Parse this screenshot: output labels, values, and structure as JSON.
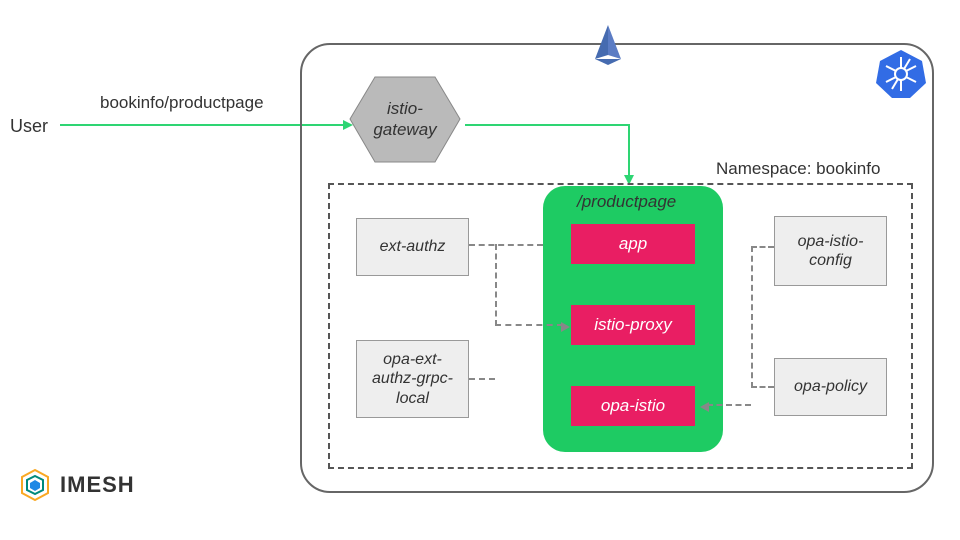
{
  "user_label": "User",
  "arrow1_label": "bookinfo/productpage",
  "gateway_label": "istio-\ngateway",
  "namespace_label": "Namespace: bookinfo",
  "productpage_label": "/productpage",
  "pods": {
    "app": "app",
    "proxy": "istio-proxy",
    "opa": "opa-istio"
  },
  "docs": {
    "ext_authz": "ext-authz",
    "opa_ext": "opa-ext-authz-grpc-local",
    "opa_config": "opa-istio-config",
    "opa_policy": "opa-policy"
  },
  "logo_text": "IMESH",
  "colors": {
    "arrow": "#2ed573",
    "pod_bg": "#e91e63",
    "product_bg": "#1ecb63",
    "hex_bg": "#bababa"
  }
}
